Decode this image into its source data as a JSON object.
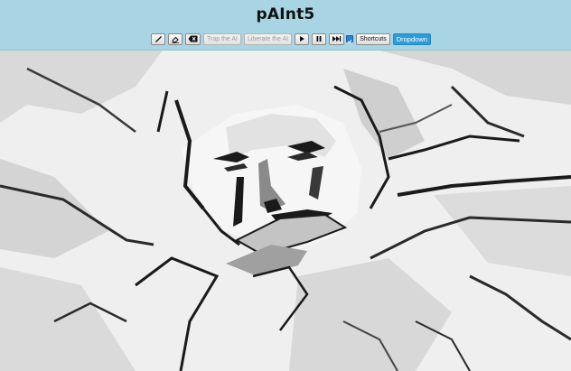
{
  "app": {
    "title": "pAInt5"
  },
  "toolbar": {
    "pencil_icon": "pencil-icon",
    "eraser_icon": "eraser-icon",
    "clear_icon": "clear-icon",
    "trap_label": "Trap the AI",
    "liberate_label": "Liberate the AI",
    "play_icon": "play-icon",
    "pause_icon": "pause-icon",
    "fast_forward_icon": "fast-forward-icon",
    "auto_checked": true,
    "shortcuts_label": "Shortcuts",
    "dropdown_label": "Dropdown"
  },
  "canvas": {
    "content": "painting-canvas",
    "colors": {
      "background": "#f0f0f0",
      "ink": "#1a1a1a",
      "shade": "#8a8a8a",
      "light_shade": "#c9c9c9"
    }
  },
  "theme": {
    "header_bg": "#a9d4e4",
    "button_blue": "#2f9bd8"
  }
}
